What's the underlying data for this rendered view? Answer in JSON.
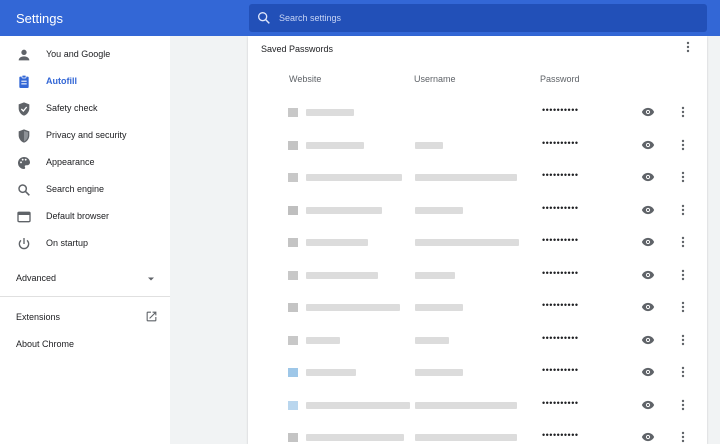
{
  "app": {
    "title": "Settings"
  },
  "search": {
    "placeholder": "Search settings"
  },
  "sidebar": {
    "items": [
      {
        "label": "You and Google",
        "icon": "person-icon"
      },
      {
        "label": "Autofill",
        "icon": "clipboard-icon",
        "active": true
      },
      {
        "label": "Safety check",
        "icon": "shield-check-icon"
      },
      {
        "label": "Privacy and security",
        "icon": "shield-icon"
      },
      {
        "label": "Appearance",
        "icon": "palette-icon"
      },
      {
        "label": "Search engine",
        "icon": "search-icon"
      },
      {
        "label": "Default browser",
        "icon": "browser-icon"
      },
      {
        "label": "On startup",
        "icon": "power-icon"
      }
    ],
    "advanced": "Advanced",
    "extensions": "Extensions",
    "about": "About Chrome"
  },
  "passwords": {
    "title": "Saved Passwords",
    "columns": {
      "website": "Website",
      "username": "Username",
      "password": "Password"
    },
    "masked_password": "••••••••••",
    "rows": 11
  },
  "colors": {
    "brand": "#3367d6",
    "search_bg": "#2250b8",
    "active": "#3367d6"
  }
}
